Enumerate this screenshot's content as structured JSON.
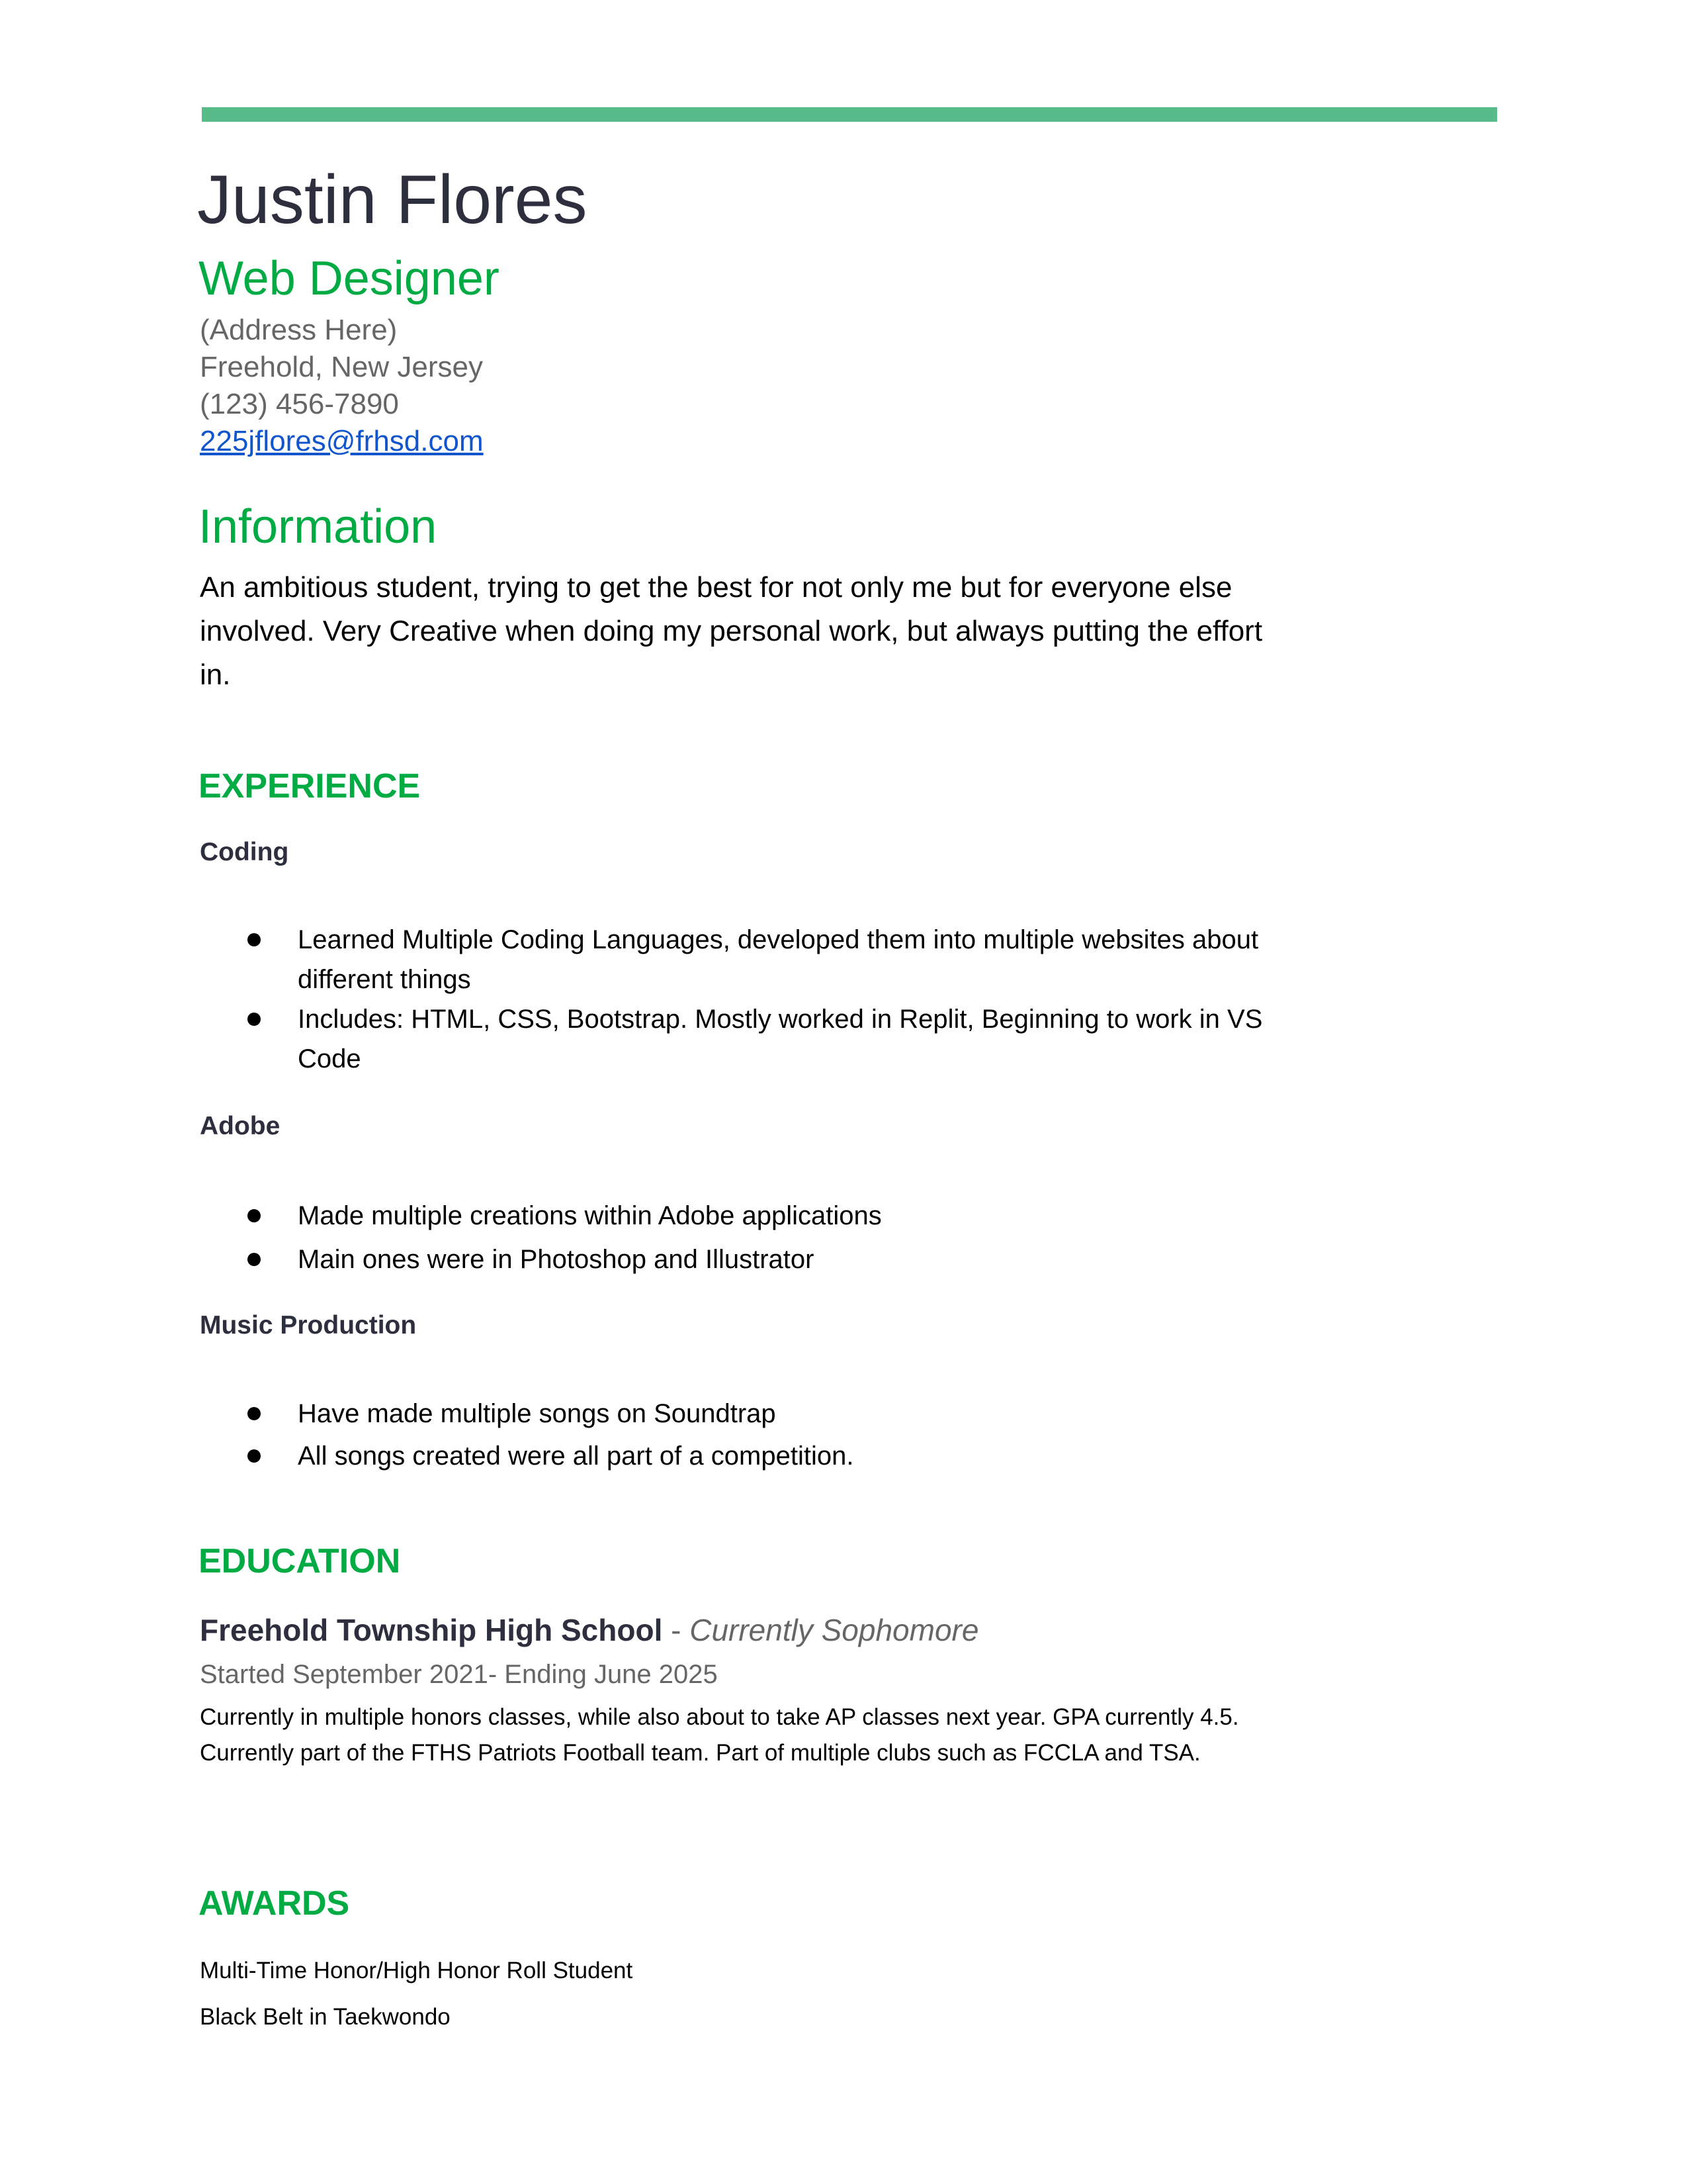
{
  "header": {
    "name": "Justin Flores",
    "role": "Web Designer",
    "address": "(Address Here)",
    "city": "Freehold, New Jersey",
    "phone": "(123) 456-7890",
    "email": "225jflores@frhsd.com"
  },
  "information": {
    "heading": "Information",
    "text": "An ambitious student, trying to get the best for not only me but for everyone else involved. Very Creative when doing my personal work, but always putting the effort in."
  },
  "experience": {
    "heading": "EXPERIENCE",
    "groups": [
      {
        "title": "Coding",
        "items": [
          "Learned Multiple Coding Languages, developed them into multiple websites about different things",
          "Includes: HTML, CSS, Bootstrap. Mostly worked in Replit, Beginning to work in VS Code"
        ]
      },
      {
        "title": "Adobe",
        "items": [
          "Made multiple creations within Adobe applications",
          "Main ones were in Photoshop and Illustrator"
        ]
      },
      {
        "title": "Music Production",
        "items": [
          "Have made multiple songs on Soundtrap",
          "All songs created were all part of a competition."
        ]
      }
    ]
  },
  "education": {
    "heading": "EDUCATION",
    "school": "Freehold Township High School",
    "separator": " - ",
    "status": "Currently Sophomore",
    "dates": "Started September 2021- Ending June 2025",
    "text": "Currently in multiple honors classes, while also about to take AP classes next year. GPA currently 4.5. Currently part of the FTHS Patriots Football team. Part of multiple clubs such as FCCLA and TSA."
  },
  "awards": {
    "heading": "AWARDS",
    "items": [
      "Multi-Time Honor/High Honor Roll Student",
      "Black Belt in Taekwondo"
    ]
  },
  "colors": {
    "accent": "#00ab44",
    "rule": "#57bb8a",
    "name": "#2d2f3e",
    "muted": "#666666",
    "link": "#1155cc"
  }
}
